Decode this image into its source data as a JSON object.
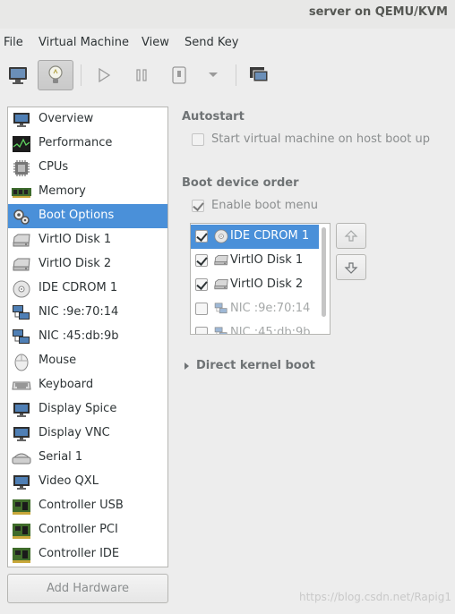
{
  "window": {
    "title": "server on QEMU/KVM"
  },
  "menu": {
    "file": "File",
    "virtual_machine": "Virtual Machine",
    "view": "View",
    "send_key": "Send Key"
  },
  "toolbar": {
    "icons": [
      "monitor-icon",
      "lightbulb-icon",
      "play-icon",
      "pause-icon",
      "power-icon",
      "dropdown-arrow-icon",
      "screenshot-icon"
    ]
  },
  "sidebar": {
    "items": [
      {
        "label": "Overview",
        "icon": "monitor-icon"
      },
      {
        "label": "Performance",
        "icon": "chart-icon"
      },
      {
        "label": "CPUs",
        "icon": "cpu-icon"
      },
      {
        "label": "Memory",
        "icon": "memory-icon"
      },
      {
        "label": "Boot Options",
        "icon": "gears-icon",
        "selected": true
      },
      {
        "label": "VirtIO Disk 1",
        "icon": "disk-icon"
      },
      {
        "label": "VirtIO Disk 2",
        "icon": "disk-icon"
      },
      {
        "label": "IDE CDROM 1",
        "icon": "cdrom-icon"
      },
      {
        "label": "NIC :9e:70:14",
        "icon": "network-icon"
      },
      {
        "label": "NIC :45:db:9b",
        "icon": "network-icon"
      },
      {
        "label": "Mouse",
        "icon": "mouse-icon"
      },
      {
        "label": "Keyboard",
        "icon": "keyboard-icon"
      },
      {
        "label": "Display Spice",
        "icon": "display-icon"
      },
      {
        "label": "Display VNC",
        "icon": "display-icon"
      },
      {
        "label": "Serial 1",
        "icon": "serial-icon"
      },
      {
        "label": "Video QXL",
        "icon": "video-icon"
      },
      {
        "label": "Controller USB",
        "icon": "controller-icon"
      },
      {
        "label": "Controller PCI",
        "icon": "controller-icon"
      },
      {
        "label": "Controller IDE",
        "icon": "controller-icon"
      }
    ],
    "add_hardware": "Add Hardware"
  },
  "autostart": {
    "title": "Autostart",
    "checkbox_label": "Start virtual machine on host boot up",
    "checked": false
  },
  "boot_order": {
    "title": "Boot device order",
    "enable_menu_label": "Enable boot menu",
    "enable_menu_checked": true,
    "devices": [
      {
        "label": "IDE CDROM 1",
        "checked": true,
        "icon": "cdrom-icon",
        "selected": true
      },
      {
        "label": "VirtIO Disk 1",
        "checked": true,
        "icon": "disk-icon"
      },
      {
        "label": "VirtIO Disk 2",
        "checked": true,
        "icon": "disk-icon"
      },
      {
        "label": "NIC :9e:70:14",
        "checked": false,
        "icon": "network-icon"
      },
      {
        "label": "NIC :45:db:9b",
        "checked": false,
        "icon": "network-icon"
      }
    ]
  },
  "direct_kernel_boot": {
    "label": "Direct kernel boot"
  },
  "watermark": "https://blog.csdn.net/Rapig1"
}
